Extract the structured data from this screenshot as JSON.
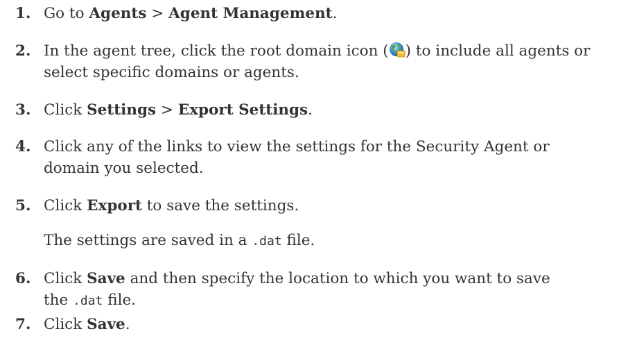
{
  "steps": [
    {
      "number": "1.",
      "parts": {
        "a": "Go to ",
        "b": "Agents",
        "c": " > ",
        "d": "Agent Management",
        "e": "."
      }
    },
    {
      "number": "2.",
      "line1_before_icon": "In the agent tree, click the root domain icon (",
      "line1_after_icon": ") to include all agents or",
      "line2": "select specific domains or agents.",
      "icon": "root-domain-globe-icon"
    },
    {
      "number": "3.",
      "parts": {
        "a": "Click ",
        "b": "Settings",
        "c": " > ",
        "d": "Export Settings",
        "e": "."
      }
    },
    {
      "number": "4.",
      "line1": "Click any of the links to view the settings for the Security Agent or",
      "line2": "domain you selected."
    },
    {
      "number": "5.",
      "parts": {
        "a": "Click ",
        "b": "Export",
        "c": " to save the settings."
      },
      "sub_before": "The settings are saved in a ",
      "sub_code": ".dat",
      "sub_after": " file."
    },
    {
      "number": "6.",
      "line1_a": "Click ",
      "line1_b": "Save",
      "line1_c": " and then specify the location to which you want to save",
      "line2_a": "the ",
      "line2_code": ".dat",
      "line2_b": " file."
    },
    {
      "number": "7.",
      "parts": {
        "a": "Click ",
        "b": "Save",
        "c": "."
      }
    }
  ]
}
